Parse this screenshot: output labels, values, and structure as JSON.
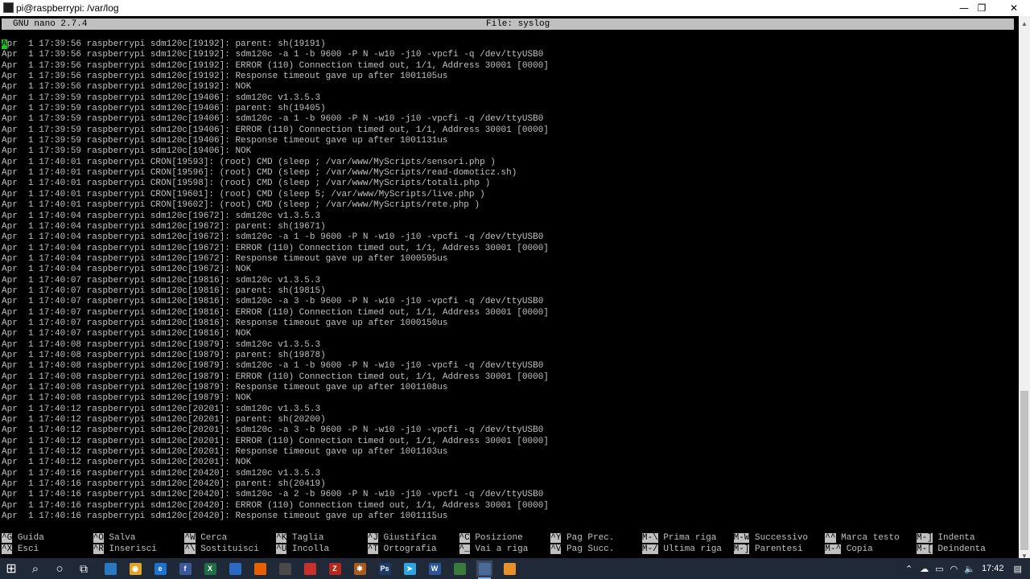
{
  "window": {
    "title": "pi@raspberrypi: /var/log",
    "minimize_glyph": "—",
    "maximize_glyph": "❐",
    "close_glyph": "✕"
  },
  "nano": {
    "version": "GNU nano 2.7.4",
    "file_label": "File: syslog"
  },
  "log": {
    "cursor_char": "A",
    "first_line_rest": "pr  1 17:39:56 raspberrypi sdm120c[19192]: parent: sh(19191)",
    "lines": [
      "Apr  1 17:39:56 raspberrypi sdm120c[19192]: sdm120c -a 1 -b 9600 -P N -w10 -j10 -vpcfi -q /dev/ttyUSB0",
      "Apr  1 17:39:56 raspberrypi sdm120c[19192]: ERROR (110) Connection timed out, 1/1, Address 30001 [0000]",
      "Apr  1 17:39:56 raspberrypi sdm120c[19192]: Response timeout gave up after 1001105us",
      "Apr  1 17:39:56 raspberrypi sdm120c[19192]: NOK",
      "Apr  1 17:39:59 raspberrypi sdm120c[19406]: sdm120c v1.3.5.3",
      "Apr  1 17:39:59 raspberrypi sdm120c[19406]: parent: sh(19405)",
      "Apr  1 17:39:59 raspberrypi sdm120c[19406]: sdm120c -a 1 -b 9600 -P N -w10 -j10 -vpcfi -q /dev/ttyUSB0",
      "Apr  1 17:39:59 raspberrypi sdm120c[19406]: ERROR (110) Connection timed out, 1/1, Address 30001 [0000]",
      "Apr  1 17:39:59 raspberrypi sdm120c[19406]: Response timeout gave up after 1001131us",
      "Apr  1 17:39:59 raspberrypi sdm120c[19406]: NOK",
      "Apr  1 17:40:01 raspberrypi CRON[19593]: (root) CMD (sleep ; /var/www/MyScripts/sensori.php )",
      "Apr  1 17:40:01 raspberrypi CRON[19596]: (root) CMD (sleep ; /var/www/MyScripts/read-domoticz.sh)",
      "Apr  1 17:40:01 raspberrypi CRON[19598]: (root) CMD (sleep ; /var/www/MyScripts/totali.php )",
      "Apr  1 17:40:01 raspberrypi CRON[19601]: (root) CMD (sleep 5; /var/www/MyScripts/live.php )",
      "Apr  1 17:40:01 raspberrypi CRON[19602]: (root) CMD (sleep ; /var/www/MyScripts/rete.php )",
      "Apr  1 17:40:04 raspberrypi sdm120c[19672]: sdm120c v1.3.5.3",
      "Apr  1 17:40:04 raspberrypi sdm120c[19672]: parent: sh(19671)",
      "Apr  1 17:40:04 raspberrypi sdm120c[19672]: sdm120c -a 1 -b 9600 -P N -w10 -j10 -vpcfi -q /dev/ttyUSB0",
      "Apr  1 17:40:04 raspberrypi sdm120c[19672]: ERROR (110) Connection timed out, 1/1, Address 30001 [0000]",
      "Apr  1 17:40:04 raspberrypi sdm120c[19672]: Response timeout gave up after 1000595us",
      "Apr  1 17:40:04 raspberrypi sdm120c[19672]: NOK",
      "Apr  1 17:40:07 raspberrypi sdm120c[19816]: sdm120c v1.3.5.3",
      "Apr  1 17:40:07 raspberrypi sdm120c[19816]: parent: sh(19815)",
      "Apr  1 17:40:07 raspberrypi sdm120c[19816]: sdm120c -a 3 -b 9600 -P N -w10 -j10 -vpcfi -q /dev/ttyUSB0",
      "Apr  1 17:40:07 raspberrypi sdm120c[19816]: ERROR (110) Connection timed out, 1/1, Address 30001 [0000]",
      "Apr  1 17:40:07 raspberrypi sdm120c[19816]: Response timeout gave up after 1000150us",
      "Apr  1 17:40:07 raspberrypi sdm120c[19816]: NOK",
      "Apr  1 17:40:08 raspberrypi sdm120c[19879]: sdm120c v1.3.5.3",
      "Apr  1 17:40:08 raspberrypi sdm120c[19879]: parent: sh(19878)",
      "Apr  1 17:40:08 raspberrypi sdm120c[19879]: sdm120c -a 1 -b 9600 -P N -w10 -j10 -vpcfi -q /dev/ttyUSB0",
      "Apr  1 17:40:08 raspberrypi sdm120c[19879]: ERROR (110) Connection timed out, 1/1, Address 30001 [0000]",
      "Apr  1 17:40:08 raspberrypi sdm120c[19879]: Response timeout gave up after 1001108us",
      "Apr  1 17:40:08 raspberrypi sdm120c[19879]: NOK",
      "Apr  1 17:40:12 raspberrypi sdm120c[20201]: sdm120c v1.3.5.3",
      "Apr  1 17:40:12 raspberrypi sdm120c[20201]: parent: sh(20200)",
      "Apr  1 17:40:12 raspberrypi sdm120c[20201]: sdm120c -a 3 -b 9600 -P N -w10 -j10 -vpcfi -q /dev/ttyUSB0",
      "Apr  1 17:40:12 raspberrypi sdm120c[20201]: ERROR (110) Connection timed out, 1/1, Address 30001 [0000]",
      "Apr  1 17:40:12 raspberrypi sdm120c[20201]: Response timeout gave up after 1001103us",
      "Apr  1 17:40:12 raspberrypi sdm120c[20201]: NOK",
      "Apr  1 17:40:16 raspberrypi sdm120c[20420]: sdm120c v1.3.5.3",
      "Apr  1 17:40:16 raspberrypi sdm120c[20420]: parent: sh(20419)",
      "Apr  1 17:40:16 raspberrypi sdm120c[20420]: sdm120c -a 2 -b 9600 -P N -w10 -j10 -vpcfi -q /dev/ttyUSB0",
      "Apr  1 17:40:16 raspberrypi sdm120c[20420]: ERROR (110) Connection timed out, 1/1, Address 30001 [0000]",
      "Apr  1 17:40:16 raspberrypi sdm120c[20420]: Response timeout gave up after 1001115us"
    ]
  },
  "shortcuts": [
    {
      "key": "^G",
      "label": "Guida"
    },
    {
      "key": "^X",
      "label": "Esci"
    },
    {
      "key": "^O",
      "label": "Salva"
    },
    {
      "key": "^R",
      "label": "Inserisci"
    },
    {
      "key": "^W",
      "label": "Cerca"
    },
    {
      "key": "^\\",
      "label": "Sostituisci"
    },
    {
      "key": "^K",
      "label": "Taglia"
    },
    {
      "key": "^U",
      "label": "Incolla"
    },
    {
      "key": "^J",
      "label": "Giustifica"
    },
    {
      "key": "^T",
      "label": "Ortografia"
    },
    {
      "key": "^C",
      "label": "Posizione"
    },
    {
      "key": "^_",
      "label": "Vai a riga"
    },
    {
      "key": "^Y",
      "label": "Pag Prec."
    },
    {
      "key": "^V",
      "label": "Pag Succ."
    },
    {
      "key": "M-\\",
      "label": "Prima riga"
    },
    {
      "key": "M-/",
      "label": "Ultima riga"
    },
    {
      "key": "M-W",
      "label": "Successivo"
    },
    {
      "key": "M-]",
      "label": "Parentesi"
    },
    {
      "key": "^^",
      "label": "Marca testo"
    },
    {
      "key": "M-^",
      "label": "Copia"
    },
    {
      "key": "M-]",
      "label": "Indenta"
    },
    {
      "key": "M-[",
      "label": "Deindenta"
    }
  ],
  "taskbar": {
    "start_glyph": "⊞",
    "search_glyph": "⌕",
    "cortana_glyph": "○",
    "taskview_glyph": "⧉",
    "apps": [
      {
        "name": "file-explorer-icon",
        "color": "#2b78c2",
        "glyph": ""
      },
      {
        "name": "chrome-icon",
        "color": "#e0a526",
        "glyph": "◉"
      },
      {
        "name": "edge-icon",
        "color": "#1a73d1",
        "glyph": "e"
      },
      {
        "name": "facebook-icon",
        "color": "#3b5998",
        "glyph": "f"
      },
      {
        "name": "excel-icon",
        "color": "#1d7044",
        "glyph": "X"
      },
      {
        "name": "onedrive-icon",
        "color": "#2a6ac2",
        "glyph": ""
      },
      {
        "name": "firefox-icon",
        "color": "#e66000",
        "glyph": ""
      },
      {
        "name": "vm-icon",
        "color": "#4a4a4a",
        "glyph": ""
      },
      {
        "name": "box-app-icon",
        "color": "#c8302d",
        "glyph": ""
      },
      {
        "name": "filezilla-icon",
        "color": "#b4281e",
        "glyph": "Z"
      },
      {
        "name": "settings-app-icon",
        "color": "#a95c1c",
        "glyph": "✱"
      },
      {
        "name": "photoshop-icon",
        "color": "#1a3b65",
        "glyph": "Ps"
      },
      {
        "name": "telegram-icon",
        "color": "#2ca5e0",
        "glyph": "➤"
      },
      {
        "name": "word-icon",
        "color": "#2b579a",
        "glyph": "W"
      },
      {
        "name": "network-app-icon",
        "color": "#3a7a3a",
        "glyph": ""
      },
      {
        "name": "putty-icon",
        "color": "#4a6a9a",
        "glyph": ""
      },
      {
        "name": "orange-app-icon",
        "color": "#e8902a",
        "glyph": ""
      }
    ],
    "active_app_index": 15,
    "clock": "17:42",
    "tray_glyphs": {
      "chevron": "⌃",
      "cloud": "☁",
      "battery": "▭",
      "wifi": "◠",
      "volume": "🔈",
      "notifications": "▤"
    }
  }
}
